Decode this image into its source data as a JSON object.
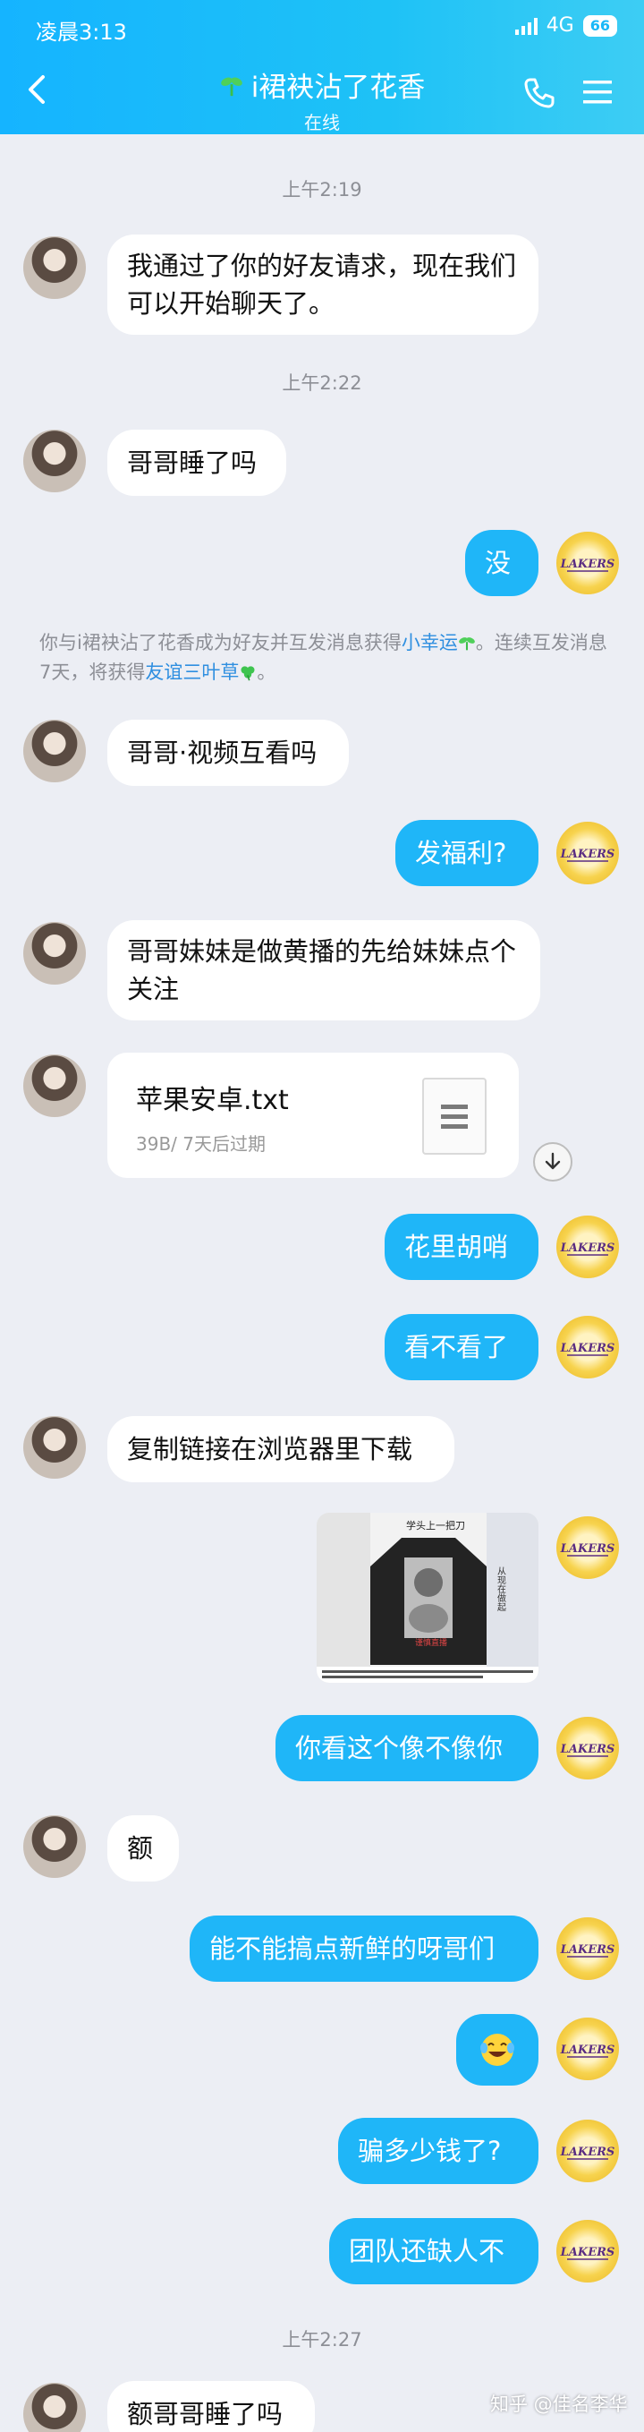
{
  "status_bar": {
    "time": "凌晨3:13",
    "network": "4G",
    "battery": "66"
  },
  "header": {
    "title": "i裙袂沾了花香",
    "subtitle": "在线"
  },
  "timestamps": [
    "上午2:19",
    "上午2:22",
    "上午2:27"
  ],
  "messages": {
    "m1": "我通过了你的好友请求，现在我们可以开始聊天了。",
    "m2": "哥哥睡了吗",
    "m3": "没",
    "m4": "哥哥·视频互看吗",
    "m5": "发福利?",
    "m6": "哥哥妹妹是做黄播的先给妹妹点个关注",
    "m7": "花里胡哨",
    "m8": "看不看了",
    "m9": "复制链接在浏览器里下载",
    "m10": "你看这个像不像你",
    "m11": "额",
    "m12": "能不能搞点新鲜的呀哥们",
    "m13": "骗多少钱了?",
    "m14": "团队还缺人不",
    "m15": "额哥哥睡了吗"
  },
  "system_notice": {
    "part1": "你与i裙袂沾了花香成为好友并互发消息获得",
    "link1": "小幸运",
    "part2": "。连续互发消息7天，将获得",
    "link2": "友谊三叶草",
    "part3": "。"
  },
  "file": {
    "name": "苹果安卓.txt",
    "meta": "39B/ 7天后过期"
  },
  "image_text": {
    "caption": "学头上一把刀",
    "side": "从现在做起",
    "bottom": "谨慎直播"
  },
  "avatar_text": "LAKERS",
  "watermark": "知乎 @佳名李华",
  "icons": [
    "back-icon",
    "sprout-icon",
    "phone-icon",
    "menu-icon",
    "clover-icon",
    "download-icon",
    "file-icon",
    "laugh-cry-emoji"
  ],
  "colors": {
    "header": "#1ab8f8",
    "bubble_self": "#1fb6f8",
    "bubble_other": "#ffffff",
    "background": "#eceef4",
    "link": "#2f8fe0"
  }
}
